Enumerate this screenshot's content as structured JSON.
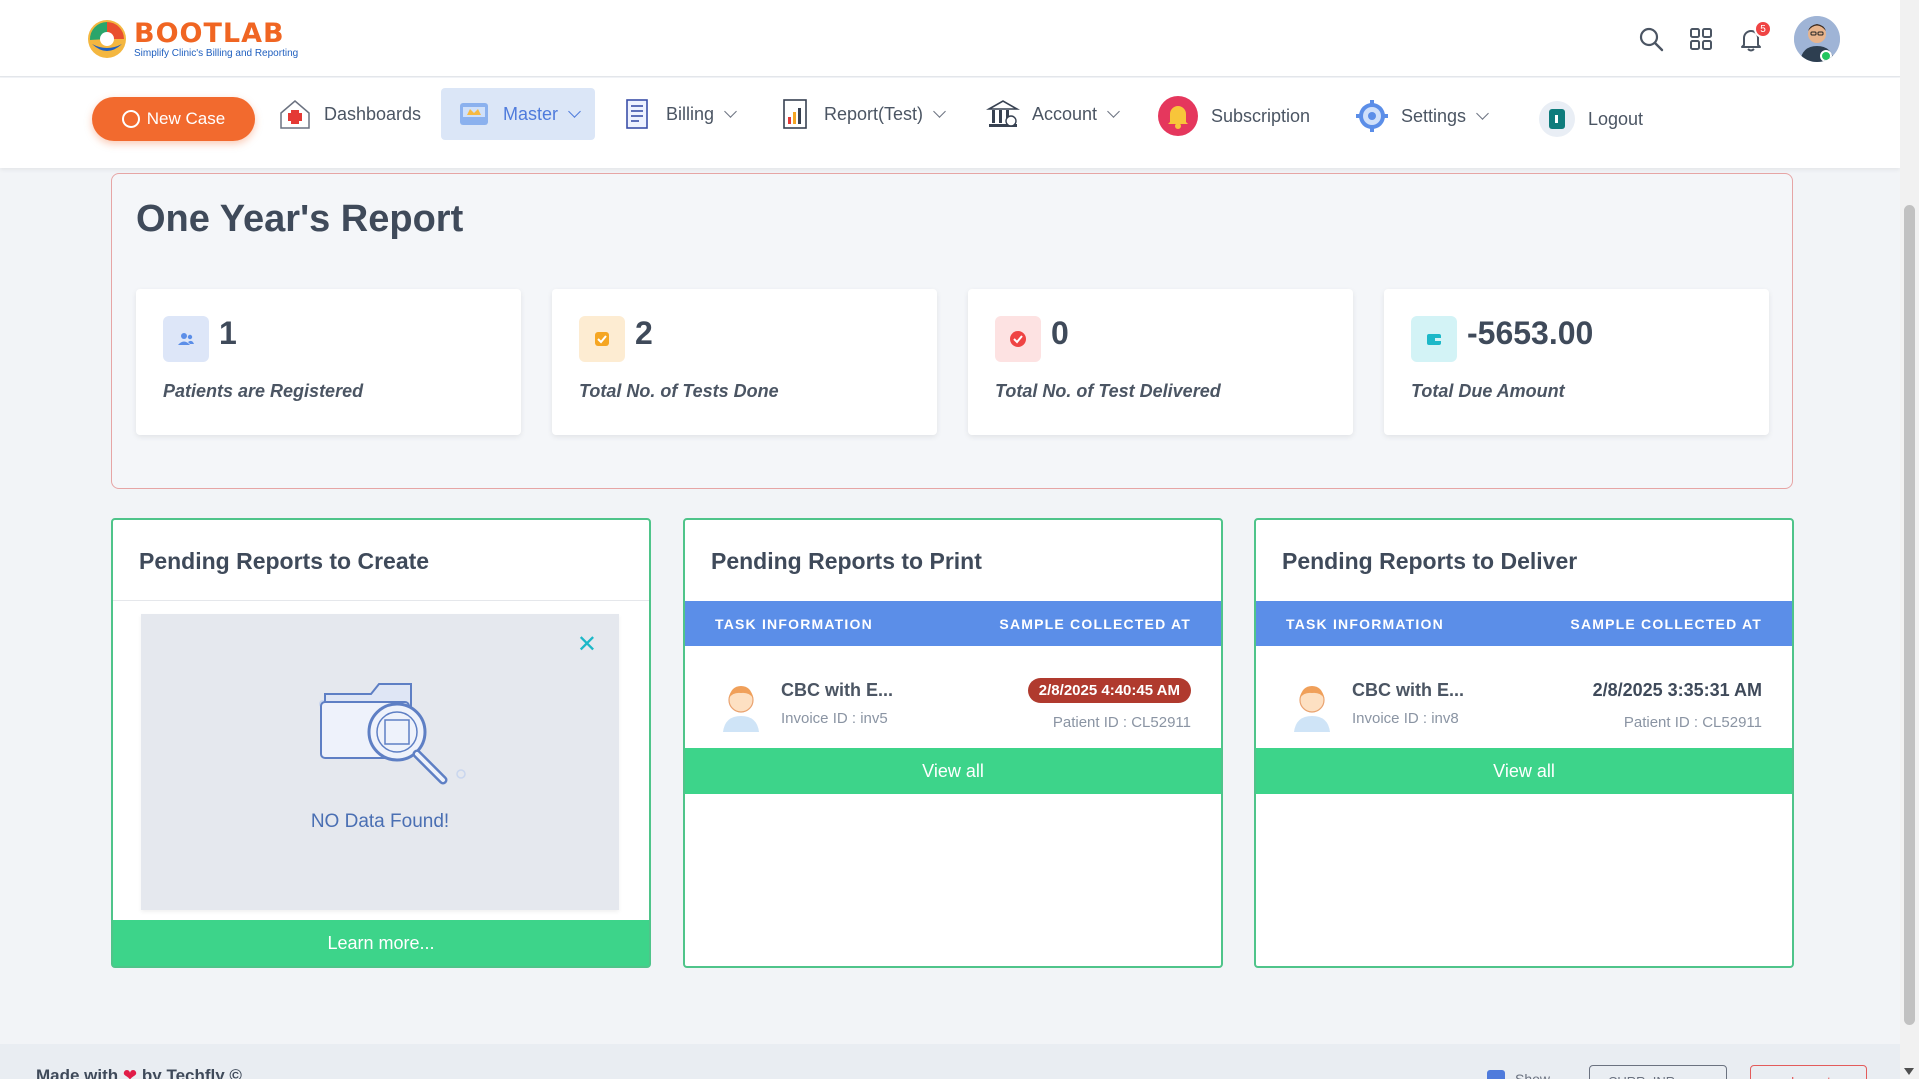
{
  "brand": {
    "name": "BOOTLAB",
    "tagline": "Simplify Clinic's Billing and Reporting",
    "colors": {
      "orange": "#f06522",
      "blue": "#1f5fbf"
    }
  },
  "header": {
    "icons": [
      "search-icon",
      "apps-grid-icon",
      "bell-icon",
      "user-avatar"
    ],
    "notification_count": "5"
  },
  "nav": {
    "new_case": "New Case",
    "items": [
      {
        "label": "Dashboards",
        "icon": "hospital-icon",
        "dropdown": false
      },
      {
        "label": "Master",
        "icon": "master-icon",
        "dropdown": true,
        "active": true
      },
      {
        "label": "Billing",
        "icon": "billing-icon",
        "dropdown": true
      },
      {
        "label": "Report(Test)",
        "icon": "report-icon",
        "dropdown": true
      },
      {
        "label": "Account",
        "icon": "bank-icon",
        "dropdown": true
      },
      {
        "label": "Subscription",
        "icon": "bell-subscription-icon",
        "dropdown": false
      },
      {
        "label": "Settings",
        "icon": "gear-icon",
        "dropdown": true
      },
      {
        "label": "Logout",
        "icon": "logout-icon",
        "dropdown": false
      }
    ]
  },
  "year_report": {
    "title": "One Year's Report",
    "stats": [
      {
        "value": "1",
        "label": "Patients are Registered",
        "icon": "users-icon",
        "color": "#5b8ee8"
      },
      {
        "value": "2",
        "label": "Total No. of Tests Done",
        "icon": "check-square-icon",
        "color": "#f5a623"
      },
      {
        "value": "0",
        "label": "Total No. of Test Delivered",
        "icon": "check-circle-icon",
        "color": "#ef4444"
      },
      {
        "value": "-5653.00",
        "label": "Total Due Amount",
        "icon": "wallet-icon",
        "color": "#1cb8c8"
      }
    ]
  },
  "panels": {
    "create": {
      "title": "Pending Reports to Create",
      "empty_text": "NO Data Found!",
      "close": "✕",
      "action": "Learn more..."
    },
    "print": {
      "title": "Pending Reports to Print",
      "columns": [
        "TASK INFORMATION",
        "SAMPLE COLLECTED AT"
      ],
      "row": {
        "task": "CBC with E...",
        "invoice": "Invoice ID : inv5",
        "collected_at": "2/8/2025 4:40:45 AM",
        "patient_id": "Patient ID : CL52911"
      },
      "action": "View all"
    },
    "deliver": {
      "title": "Pending Reports to Deliver",
      "columns": [
        "TASK INFORMATION",
        "SAMPLE COLLECTED AT"
      ],
      "row": {
        "task": "CBC with E...",
        "invoice": "Invoice ID : inv8",
        "collected_at": "2/8/2025 3:35:31 AM",
        "patient_id": "Patient ID : CL52911"
      },
      "action": "View all"
    }
  },
  "footer": {
    "made_with": "Made with",
    "by": "by Techfly ©",
    "show_label": "Show",
    "currency": "CURR: INR",
    "logout": "Logout"
  }
}
